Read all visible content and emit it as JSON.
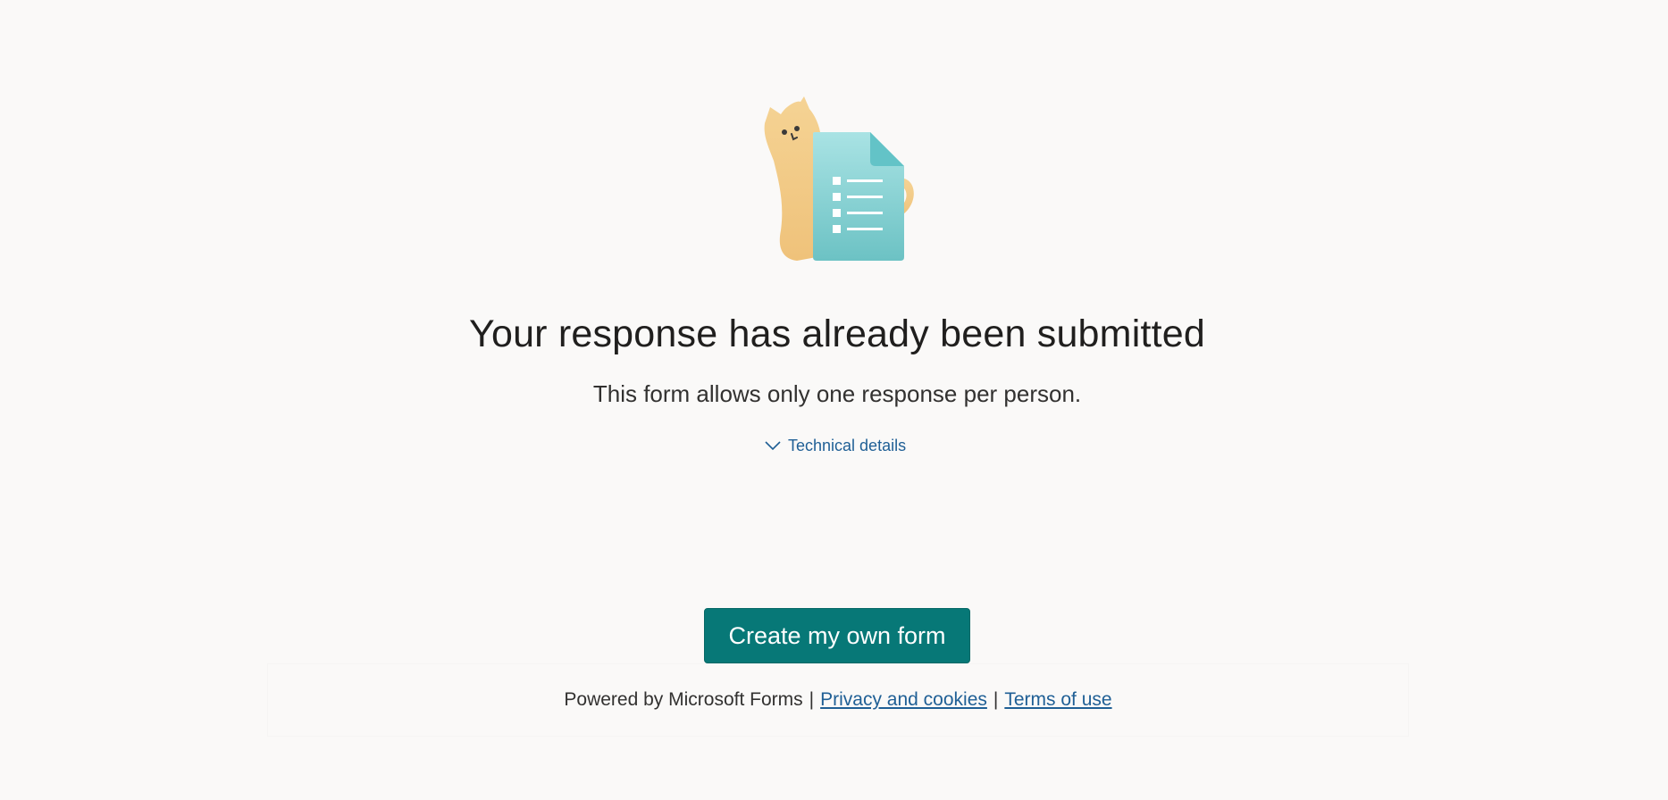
{
  "illustration": {
    "icon": "cat-with-form-icon",
    "colors": {
      "cat": "#f3cd8a",
      "document": "#7ecdd0",
      "document_fold": "#63c3c7",
      "lines": "#ffffff"
    }
  },
  "message": {
    "title": "Your response has already been submitted",
    "subtitle": "This form allows only one response per person."
  },
  "technical_details": {
    "label": "Technical details",
    "icon": "chevron-down-icon"
  },
  "create_button": {
    "label": "Create my own form",
    "color": "#077877"
  },
  "footer": {
    "powered_by": "Powered by Microsoft Forms",
    "separator": "|",
    "privacy_link": "Privacy and cookies",
    "terms_link": "Terms of use",
    "link_color": "#1f5f95"
  }
}
